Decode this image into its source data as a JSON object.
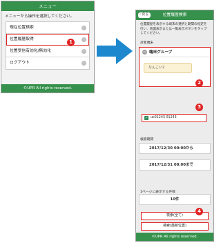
{
  "menu_screen": {
    "title": "メニュー",
    "intro": "メニューから操作を選択してください。",
    "items": [
      {
        "label": "現在位置検索"
      },
      {
        "label": "位置履歴取得"
      },
      {
        "label": "位置受信有効化/無効化"
      },
      {
        "label": "ログアウト"
      }
    ],
    "chevron": "›",
    "footer": "©UPR All rights reserved."
  },
  "callouts": [
    "1",
    "2",
    "3",
    "4"
  ],
  "arrow_color": "#1e88cf",
  "accent_color": "#36914c",
  "highlight_color": "#e02424",
  "history_screen": {
    "back_label": "戻る",
    "title": "位置履歴検索",
    "intro": "位置履歴を表示する端末の選択と期間の指定を行い、地図表示または一覧表示ボタンをタップしてください。",
    "target_label": "対象端末",
    "group_label": "端末グループ",
    "group_input_value": "なんこい2",
    "device_label": "uc01243 01243",
    "period_label": "検索期間",
    "date_from": "2017/12/30 00:00から",
    "date_to": "2017/12/31 00:00まで",
    "per_page_label": "1ページに表示する件数",
    "per_page_value": "10件",
    "search_all_button": "検索(全て)",
    "search_latest_button": "検索(最新位置)",
    "footer": "©UPR All rights reserved."
  }
}
